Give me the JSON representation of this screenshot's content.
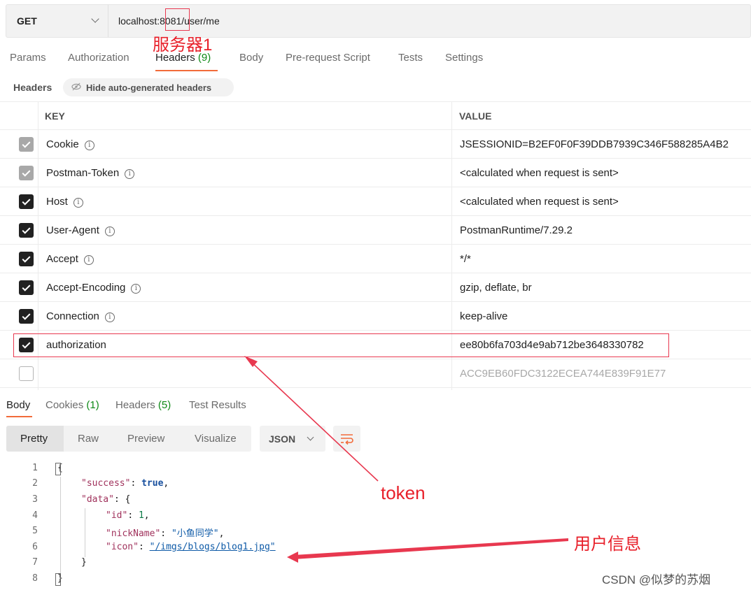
{
  "request": {
    "method": "GET",
    "url": "localhost:8081/user/me"
  },
  "request_tabs": [
    {
      "label": "Params",
      "count": ""
    },
    {
      "label": "Authorization",
      "count": ""
    },
    {
      "label": "Headers",
      "count": "(9)"
    },
    {
      "label": "Body",
      "count": ""
    },
    {
      "label": "Pre-request Script",
      "count": ""
    },
    {
      "label": "Tests",
      "count": ""
    },
    {
      "label": "Settings",
      "count": ""
    }
  ],
  "headers_section": {
    "label": "Headers",
    "hide_button": "Hide auto-generated headers",
    "col_key": "KEY",
    "col_value": "VALUE"
  },
  "headers": [
    {
      "key": "Cookie",
      "value": "JSESSIONID=B2EF0F0F39DDB7939C346F588285A4B2",
      "state": "auto"
    },
    {
      "key": "Postman-Token",
      "value": "<calculated when request is sent>",
      "state": "auto"
    },
    {
      "key": "Host",
      "value": "<calculated when request is sent>",
      "state": "on"
    },
    {
      "key": "User-Agent",
      "value": "PostmanRuntime/7.29.2",
      "state": "on"
    },
    {
      "key": "Accept",
      "value": "*/*",
      "state": "on"
    },
    {
      "key": "Accept-Encoding",
      "value": "gzip, deflate, br",
      "state": "on"
    },
    {
      "key": "Connection",
      "value": "keep-alive",
      "state": "on"
    },
    {
      "key": "authorization",
      "value": "ee80b6fa703d4e9ab712be3648330782",
      "state": "on"
    },
    {
      "key": "",
      "value": "ACC9EB60FDC3122ECEA744E839F91E77",
      "state": "off"
    }
  ],
  "response_tabs": [
    {
      "label": "Body",
      "count": ""
    },
    {
      "label": "Cookies",
      "count": "(1)"
    },
    {
      "label": "Headers",
      "count": "(5)"
    },
    {
      "label": "Test Results",
      "count": ""
    }
  ],
  "view_modes": [
    "Pretty",
    "Raw",
    "Preview",
    "Visualize"
  ],
  "format": "JSON",
  "code": {
    "line_numbers": [
      "1",
      "2",
      "3",
      "4",
      "5",
      "6",
      "7",
      "8"
    ],
    "success_key": "\"success\"",
    "success_val": "true",
    "data_key": "\"data\"",
    "id_key": "\"id\"",
    "id_val": "1",
    "nick_key": "\"nickName\"",
    "nick_val": "\"小鱼同学\"",
    "icon_key": "\"icon\"",
    "icon_val": "\"/imgs/blogs/blog1.jpg\""
  },
  "annotations": {
    "server": "服务器1",
    "token": "token",
    "user_info": "用户信息"
  },
  "watermark": "CSDN @似梦的苏烟",
  "colors": {
    "accent_tab": "#f26b3a",
    "count_green": "#0e8a16",
    "annotation_red": "#e8202a"
  },
  "icons": {
    "method_dropdown": "chevron-down-icon",
    "hide_headers": "eye-off-icon",
    "header_info": "info-icon",
    "format_dropdown": "chevron-down-icon",
    "wrap_toggle": "wrap-lines-icon"
  }
}
